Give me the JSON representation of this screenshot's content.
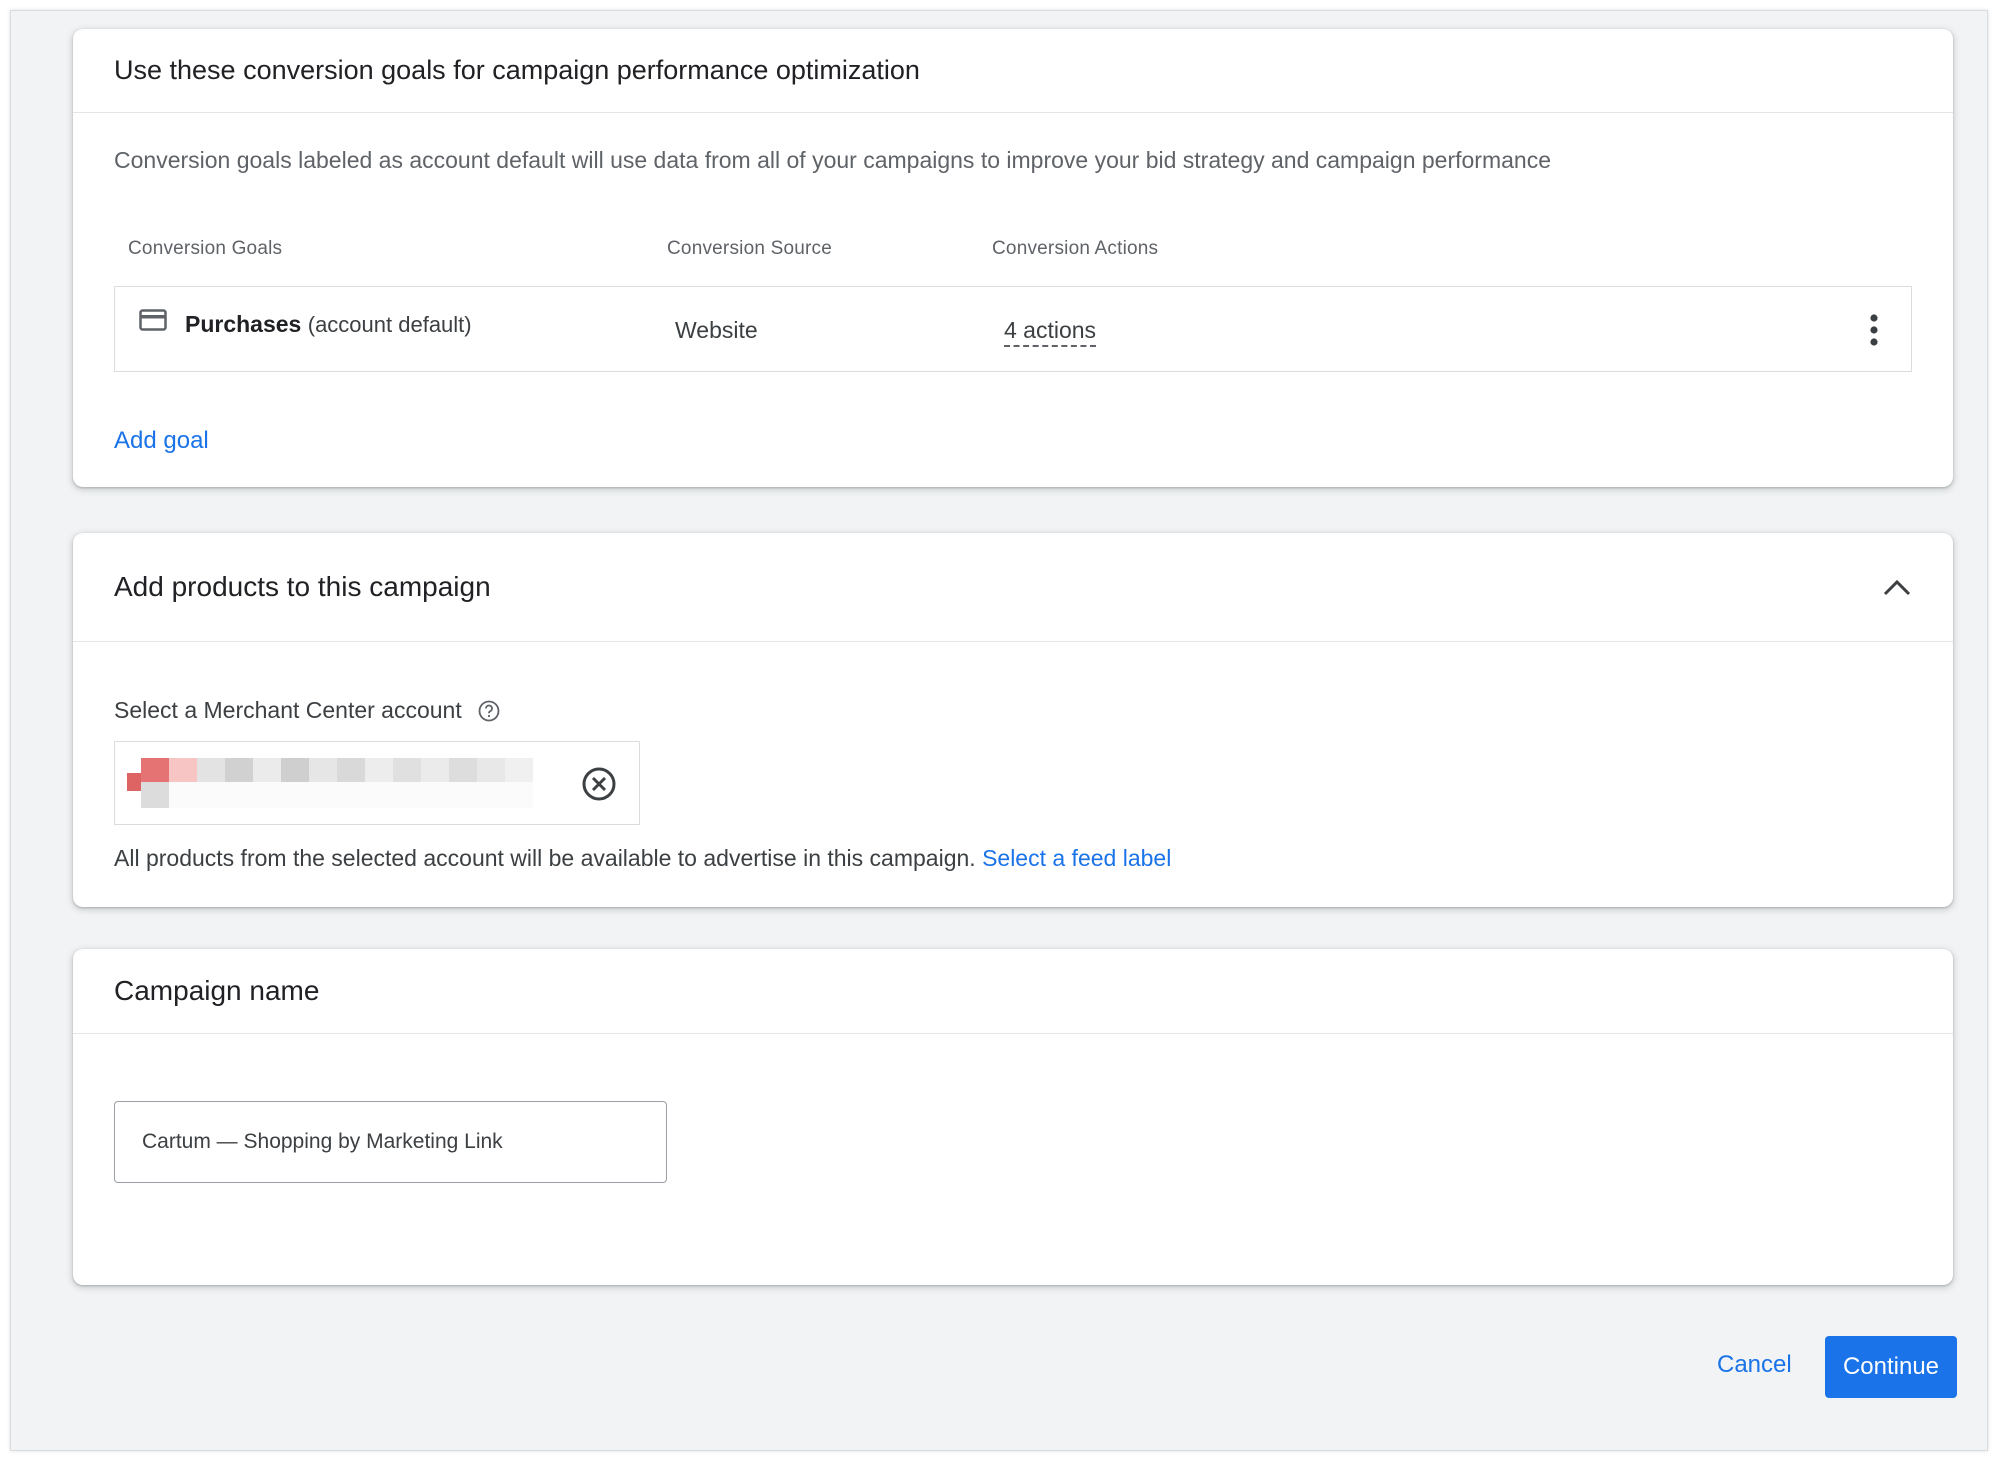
{
  "conversion_card": {
    "title": "Use these conversion goals for campaign performance optimization",
    "description": "Conversion goals labeled as account default will use data from all of your campaigns to improve your bid strategy and campaign performance",
    "columns": [
      "Conversion Goals",
      "Conversion Source",
      "Conversion Actions"
    ],
    "goals": [
      {
        "icon": "credit-card-icon",
        "name": "Purchases",
        "note": "(account default)",
        "source": "Website",
        "actions": "4 actions"
      }
    ],
    "add_goal_label": "Add goal"
  },
  "products_card": {
    "title": "Add products to this campaign",
    "merchant_label": "Select a Merchant Center account",
    "help_text": "All products from the selected account will be available to advertise in this campaign.",
    "feed_link": "Select a feed label"
  },
  "campaign_name_card": {
    "title": "Campaign name",
    "value": "Cartum — Shopping by Marketing Link"
  },
  "footer": {
    "cancel_label": "Cancel",
    "continue_label": "Continue"
  },
  "colors": {
    "accent": "#1a73e8",
    "background": "#f1f3f4"
  }
}
